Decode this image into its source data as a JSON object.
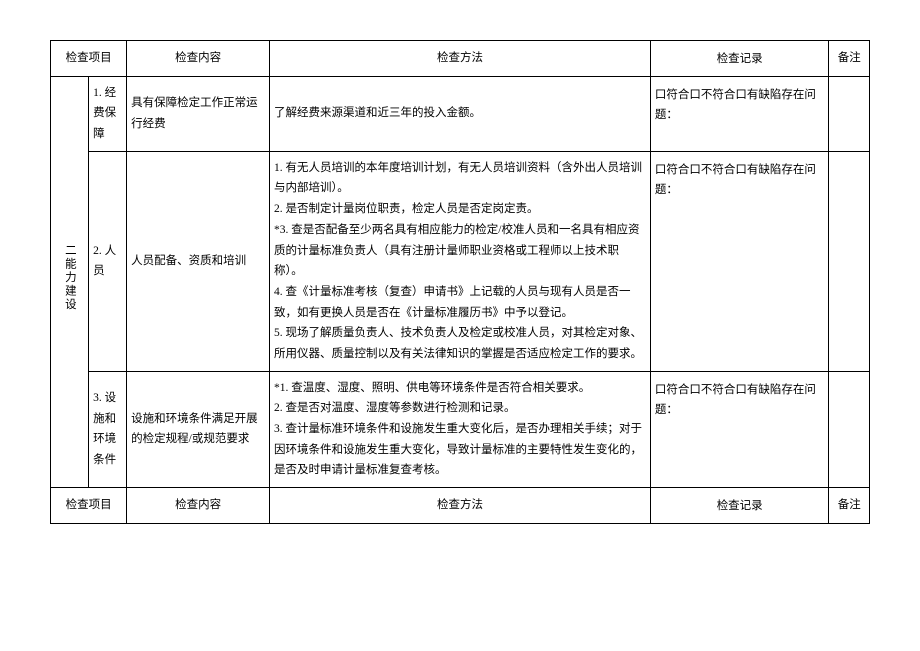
{
  "headers": {
    "item": "检查项目",
    "content": "检查内容",
    "method": "检查方法",
    "record": "检查记录",
    "note": "备注"
  },
  "section_label": "二能力建设",
  "rows": [
    {
      "item": "1. 经费保障",
      "content": "具有保障检定工作正常运行经费",
      "method": "了解经费来源渠道和近三年的投入金额。",
      "record": "口符合口不符合口有缺陷存在问题："
    },
    {
      "item": "2. 人员",
      "content": "人员配备、资质和培训",
      "method": "1. 有无人员培训的本年度培训计划，有无人员培训资料（含外出人员培训与内部培训）。\n2. 是否制定计量岗位职责，检定人员是否定岗定责。\n*3. 查是否配备至少两名具有相应能力的检定/校准人员和一名具有相应资质的计量标准负责人（具有注册计量师职业资格或工程师以上技术职称）。\n4. 查《计量标准考核（复查）申请书》上记载的人员与现有人员是否一致，如有更换人员是否在《计量标准履历书》中予以登记。\n5. 现场了解质量负责人、技术负责人及检定或校准人员，对其检定对象、所用仪器、质量控制以及有关法律知识的掌握是否适应检定工作的要求。",
      "record": "口符合口不符合口有缺陷存在问题："
    },
    {
      "item": "3. 设施和环境条件",
      "content": "设施和环境条件满足开展的检定规程/或规范要求",
      "method": "*1. 查温度、湿度、照明、供电等环境条件是否符合相关要求。\n2. 查是否对温度、湿度等参数进行检测和记录。\n3. 查计量标准环境条件和设施发生重大变化后，是否办理相关手续；对于因环境条件和设施发生重大变化，导致计量标准的主要特性发生变化的，是否及时申请计量标准复查考核。",
      "record": "口符合口不符合口有缺陷存在问题："
    }
  ]
}
